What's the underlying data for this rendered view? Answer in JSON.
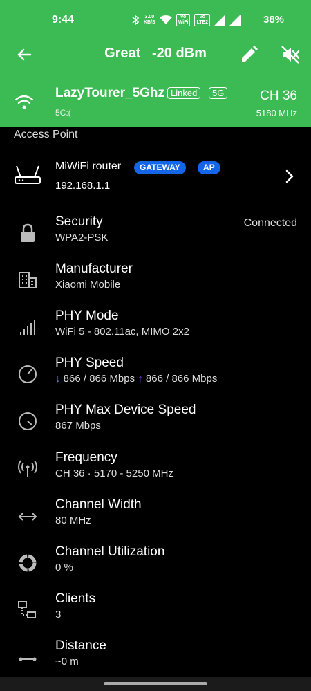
{
  "status_bar": {
    "time": "9:44",
    "speed_value": "3.00",
    "speed_unit": "KB/S",
    "wifi_badge_top": "Vo",
    "wifi_badge_bottom": "WiFi",
    "lte_badge_top": "Vo",
    "lte_badge_bottom": "LTE2",
    "battery": "38%"
  },
  "toolbar": {
    "signal_title": "Great   -20 dBm"
  },
  "network": {
    "ssid": "LazyTourer_5Ghz",
    "linked_tag": "Linked",
    "band_tag": "5G",
    "bssid": "5C:(",
    "channel": "CH 36",
    "frequency": "5180 MHz"
  },
  "access_point": {
    "section_label": "Access Point",
    "router_name": "MiWiFi router",
    "gateway_badge": "GATEWAY",
    "ap_badge": "AP",
    "ip": "192.168.1.1"
  },
  "details": {
    "security": {
      "label": "Security",
      "value": "WPA2-PSK",
      "status": "Connected"
    },
    "manufacturer": {
      "label": "Manufacturer",
      "value": "Xiaomi Mobile"
    },
    "phy_mode": {
      "label": "PHY Mode",
      "value": "WiFi 5 - 802.11ac, MIMO 2x2"
    },
    "phy_speed": {
      "label": "PHY Speed",
      "down_arrow": "↓",
      "down": "866 / 866 Mbps",
      "up_arrow": "↑",
      "up": "866 / 866 Mbps"
    },
    "phy_max": {
      "label": "PHY Max Device Speed",
      "value": "867 Mbps"
    },
    "frequency": {
      "label": "Frequency",
      "value": "CH 36 · 5170 - 5250 MHz"
    },
    "channel_width": {
      "label": "Channel Width",
      "value": "80 MHz"
    },
    "channel_util": {
      "label": "Channel Utilization",
      "value": "0 %"
    },
    "clients": {
      "label": "Clients",
      "value": "3"
    },
    "distance": {
      "label": "Distance",
      "value": "~0 m"
    }
  },
  "colors": {
    "header_green": "#3cba54",
    "badge_blue": "#1565e8",
    "download_blue": "#4a8cf0",
    "upload_purple": "#8a3cf0"
  },
  "icons": [
    "back-arrow-icon",
    "edit-pencil-icon",
    "mute-icon",
    "wifi-icon",
    "router-icon",
    "chevron-right-icon",
    "lock-icon",
    "building-icon",
    "signal-bars-icon",
    "speedometer-icon",
    "antenna-icon",
    "width-arrows-icon",
    "donut-icon",
    "clients-network-icon",
    "distance-icon"
  ]
}
